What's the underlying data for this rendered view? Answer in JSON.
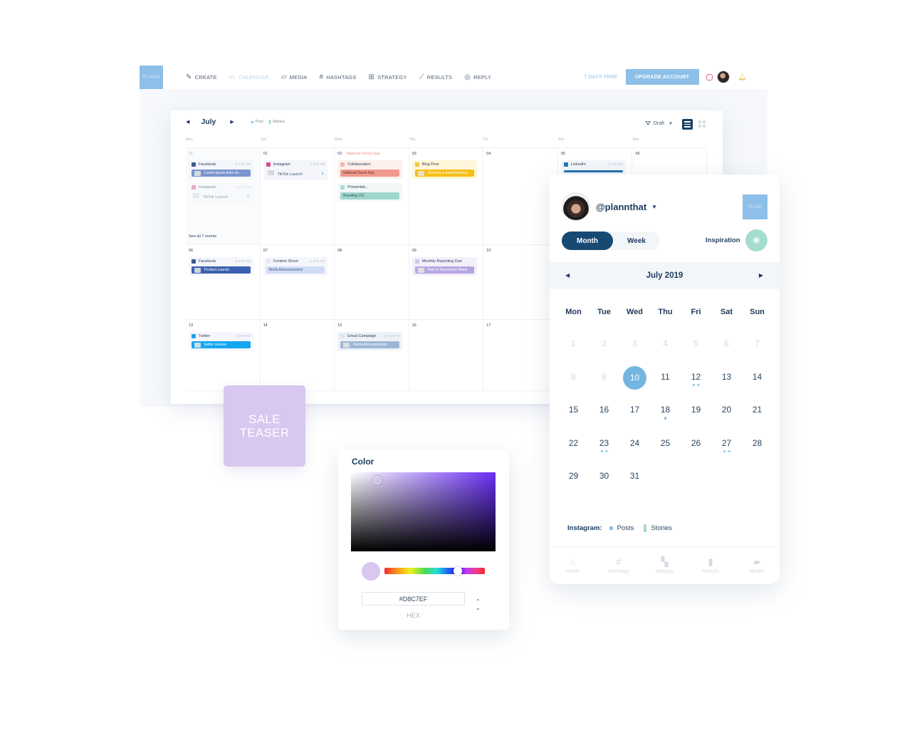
{
  "app": {
    "logo_text": "PLANN",
    "nav": [
      {
        "label": "CREATE",
        "icon": "edit-icon",
        "glyph": "✎",
        "active": false
      },
      {
        "label": "CALENDAR",
        "icon": "calendar-icon",
        "glyph": "▭",
        "active": true
      },
      {
        "label": "MEDIA",
        "icon": "folder-icon",
        "glyph": "▱",
        "active": false
      },
      {
        "label": "HASHTAGS",
        "icon": "hashtag-icon",
        "glyph": "#",
        "active": false
      },
      {
        "label": "STRATEGY",
        "icon": "grid-icon",
        "glyph": "⊞",
        "active": false
      },
      {
        "label": "RESULTS",
        "icon": "trend-icon",
        "glyph": "⟋",
        "active": false
      },
      {
        "label": "REPLY",
        "icon": "reply-icon",
        "glyph": "◎",
        "active": false
      }
    ],
    "trial_text": "7 DAYS FREE",
    "upgrade_label": "UPGRADE ACCOUNT"
  },
  "calendar": {
    "month": "July",
    "legend": {
      "post": "Post",
      "stories": "Stories"
    },
    "filter_label": "Draft",
    "weekdays": [
      "Mon",
      "Tue",
      "Wed",
      "Thu",
      "Fri",
      "Sat",
      "Sun"
    ],
    "weeks": [
      [
        {
          "num": "31",
          "muted": true,
          "events": [
            {
              "source": "Facebook",
              "src_color": "#3b5998",
              "time": "4:00 PM",
              "bar": "Lorem ipsum dolor sit...",
              "bar_color": "#7c94cf",
              "bg": "#f4f6fb"
            },
            {
              "source": "Instagram",
              "src_color": "#e2649a",
              "time": "4:00 PM",
              "sub": "TikTok Launch",
              "bg": "#f6f8fb",
              "faded": true
            }
          ],
          "see_all": "See all 7 events"
        },
        {
          "num": "01",
          "events": [
            {
              "source": "Instagram",
              "src_color": "#d9488d",
              "time": "5:00 PM",
              "sub": "TikTok Launch",
              "bg": "#f4f6fb"
            }
          ]
        },
        {
          "num": "02",
          "holiday": "National Donut Day",
          "events": [
            {
              "source": "Collaboration",
              "src_color": "#f5b8a8",
              "time": "",
              "bar": "National Donut Day",
              "bar_color": "#f0998d",
              "bar_text": "#5b2f2a",
              "bg": "#fdf0ed"
            },
            {
              "source": "Presentati...",
              "src_color": "#a9dcd2",
              "time": "",
              "bar": "Branding 101",
              "bar_color": "#9fd6cd",
              "bar_text": "#285a55",
              "bg": "#f1f8f7"
            }
          ]
        },
        {
          "num": "03",
          "events": [
            {
              "source": "Blog Post",
              "src_color": "#f5c542",
              "time": "",
              "bar": "Growing a small business",
              "bar_color": "#f7be16",
              "bg": "#fff6d9"
            }
          ]
        },
        {
          "num": "04",
          "events": []
        },
        {
          "num": "05",
          "events": [
            {
              "source": "LinkedIn",
              "src_color": "#1a78b8",
              "time": "2:00 PM",
              "bar": "",
              "bar_color": "#1a6fae",
              "bg": "#f4f6fb",
              "thin": true
            }
          ]
        },
        {
          "num": "06",
          "events": []
        }
      ],
      [
        {
          "num": "06",
          "events": [
            {
              "source": "Facebook",
              "src_color": "#3b5998",
              "time": "4:00 PM",
              "bar": "Product Launch",
              "bar_color": "#3d61b0",
              "bg": "#f4f6fb"
            }
          ]
        },
        {
          "num": "07",
          "events": [
            {
              "source": "Content Shoot",
              "src_color": "#e4e8ee",
              "time": "4:00 PM",
              "bar": "Reels Announcement",
              "bar_color": "#cfdcf5",
              "bar_text": "#3b557c",
              "bg": "#f4f6fb"
            }
          ]
        },
        {
          "num": "08",
          "events": []
        },
        {
          "num": "09",
          "events": [
            {
              "source": "Monthly Reporting Due",
              "src_color": "#d4c7ef",
              "time": "",
              "bar": "How to Repurpose Reels",
              "bar_color": "#b8a6e3",
              "bg": "#f3effb"
            }
          ]
        },
        {
          "num": "10",
          "events": []
        },
        {
          "num": "",
          "events": []
        },
        {
          "num": "",
          "events": []
        }
      ],
      [
        {
          "num": "13",
          "events": [
            {
              "source": "Twitter",
              "src_color": "#1da1f2",
              "time": "2:00 PM",
              "bar": "twitter release",
              "bar_color": "#15a6ef",
              "bg": "#f4f6fb"
            }
          ]
        },
        {
          "num": "14",
          "events": []
        },
        {
          "num": "15",
          "events": [
            {
              "source": "Email Campaign",
              "src_color": "#dfe5ee",
              "time": "4:00 PM",
              "bar": "Reels Announcement",
              "bar_color": "#9db6d6",
              "bg": "#eef2f8"
            }
          ]
        },
        {
          "num": "16",
          "events": []
        },
        {
          "num": "17",
          "events": []
        },
        {
          "num": "",
          "events": []
        },
        {
          "num": "",
          "events": []
        }
      ]
    ]
  },
  "sale_teaser": {
    "line1": "SALE",
    "line2": "TEASER",
    "color": "#D8C7EF"
  },
  "color_picker": {
    "title": "Color",
    "hex_value": "#D8C7EF",
    "hex_label": "HEX",
    "hue_position": 0.73
  },
  "planner": {
    "handle": "@plannthat",
    "logo_text": "PLANN",
    "view_options": [
      "Month",
      "Week"
    ],
    "active_view": "Month",
    "inspiration_label": "Inspiration",
    "month_title": "July 2019",
    "weekdays": [
      "Mon",
      "Tue",
      "Wed",
      "Thu",
      "Fri",
      "Sat",
      "Sun"
    ],
    "selected_day": 10,
    "days": [
      {
        "d": 1,
        "past": true
      },
      {
        "d": 2,
        "past": true
      },
      {
        "d": 3,
        "past": true
      },
      {
        "d": 4,
        "past": true
      },
      {
        "d": 5,
        "past": true
      },
      {
        "d": 6,
        "past": true
      },
      {
        "d": 7,
        "past": true
      },
      {
        "d": 8,
        "past": true
      },
      {
        "d": 9,
        "past": true
      },
      {
        "d": 10
      },
      {
        "d": 11
      },
      {
        "d": 12,
        "dots": [
          "post",
          "story"
        ]
      },
      {
        "d": 13
      },
      {
        "d": 14
      },
      {
        "d": 15
      },
      {
        "d": 16
      },
      {
        "d": 17
      },
      {
        "d": 18,
        "dots": [
          "post"
        ]
      },
      {
        "d": 19
      },
      {
        "d": 20
      },
      {
        "d": 21
      },
      {
        "d": 22
      },
      {
        "d": 23,
        "dots": [
          "post",
          "story"
        ]
      },
      {
        "d": 24
      },
      {
        "d": 25
      },
      {
        "d": 26
      },
      {
        "d": 27,
        "dots": [
          "post",
          "story"
        ]
      },
      {
        "d": 28
      },
      {
        "d": 29
      },
      {
        "d": 30
      },
      {
        "d": 31
      }
    ],
    "legend": {
      "label": "Instagram:",
      "posts": "Posts",
      "stories": "Stories"
    },
    "tabs": [
      {
        "label": "Home",
        "icon": "home-icon",
        "glyph": "⌂"
      },
      {
        "label": "Hashtags",
        "icon": "hashtag-icon",
        "glyph": "#"
      },
      {
        "label": "Strategy",
        "icon": "grid-icon",
        "glyph": "▚"
      },
      {
        "label": "Results",
        "icon": "bar-chart-icon",
        "glyph": "▮"
      },
      {
        "label": "Media",
        "icon": "folder-icon",
        "glyph": "▰"
      }
    ]
  }
}
